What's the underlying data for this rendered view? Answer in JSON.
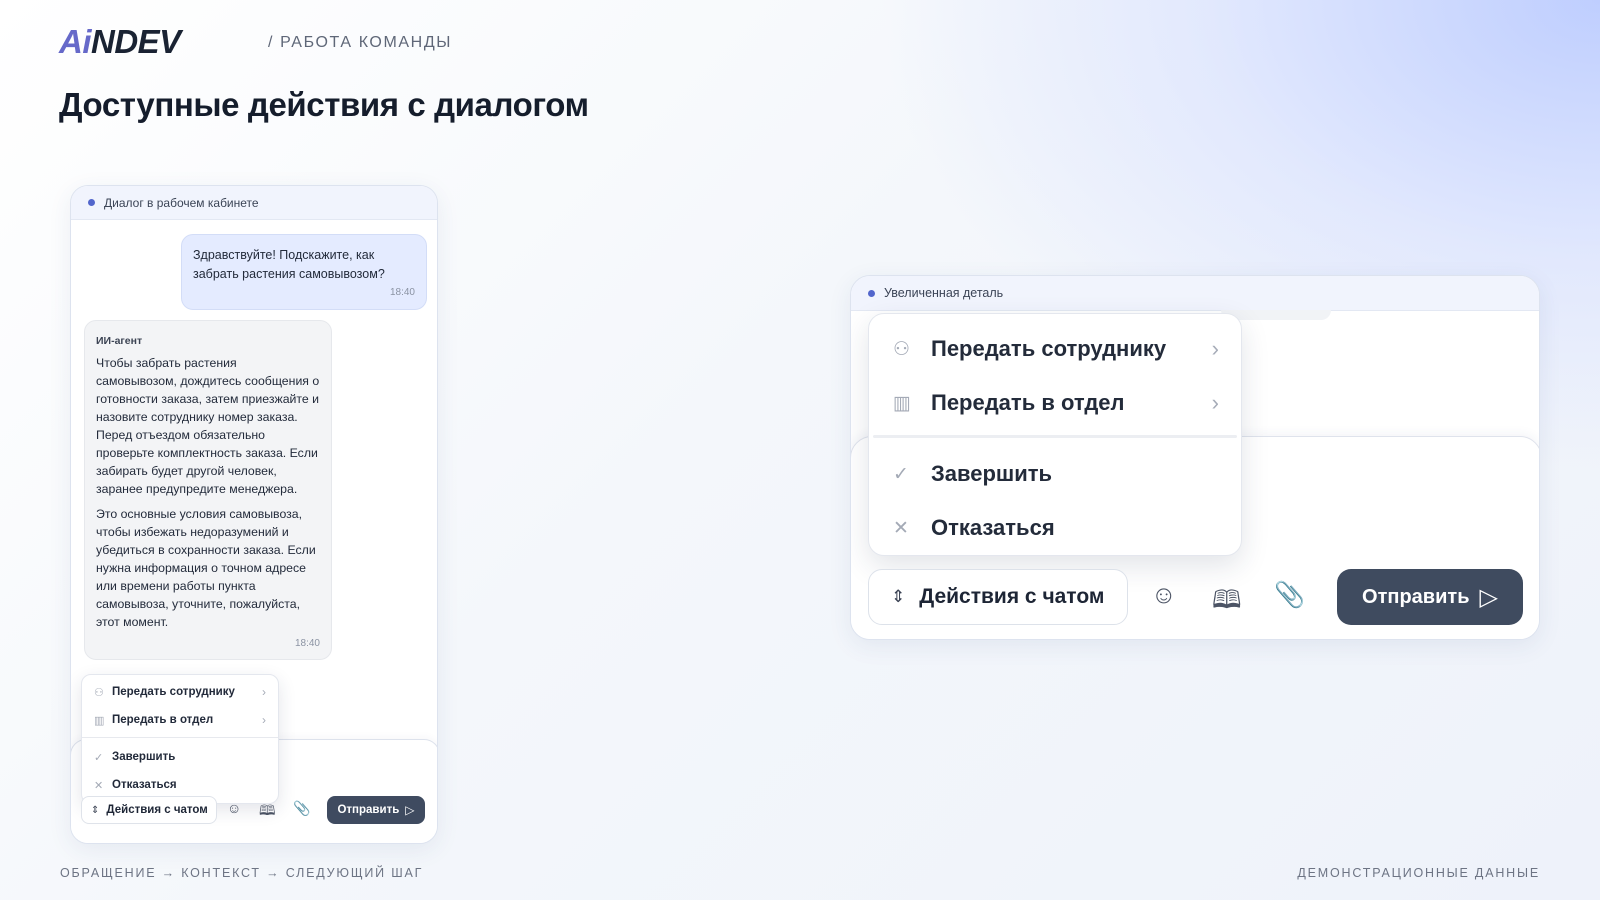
{
  "header": {
    "logo_ai": "Ai",
    "logo_rest": "NDEV",
    "breadcrumb": "/ РАБОТА КОМАНДЫ",
    "title": "Доступные действия с диалогом"
  },
  "footer": {
    "left": "ОБРАЩЕНИЕ → КОНТЕКСТ → СЛЕДУЮЩИЙ ШАГ",
    "right": "ДЕМОНСТРАЦИОННЫЕ ДАННЫЕ"
  },
  "colors": {
    "accent": "#5266cc",
    "user_bubble": "#e4ebff",
    "send_button": "#3f4b60",
    "logo_ai": "#6669c9"
  },
  "small_card": {
    "header": "Диалог в рабочем кабинете",
    "user_message": {
      "text": "Здравствуйте! Подскажите, как забрать растения самовывозом?",
      "time": "18:40"
    },
    "agent_message": {
      "sender": "ИИ-агент",
      "paragraph1": "Чтобы забрать растения самовывозом, дождитесь сообщения о готовности заказа, затем приезжайте и назовите сотруднику номер заказа. Перед отъездом обязательно проверьте комплектность заказа. Если забирать будет другой человек, заранее предупредите менеджера.",
      "paragraph2": "Это основные условия самовывоза, чтобы избежать недоразумений и убедиться в сохранности заказа. Если нужна информация о точном адресе или времени работы пункта самовывоза, уточните, пожалуйста, этот момент.",
      "time": "18:40"
    }
  },
  "big_card": {
    "header": "Увеличенная деталь"
  },
  "menu": {
    "items": [
      {
        "label": "Передать сотруднику",
        "icon": "person-plus-icon",
        "glyph": "⚇",
        "chevron": "›"
      },
      {
        "label": "Передать в отдел",
        "icon": "building-icon",
        "glyph": "▥",
        "chevron": "›"
      },
      {
        "label": "Завершить",
        "icon": "check-circle-icon",
        "glyph": "✓"
      },
      {
        "label": "Отказаться",
        "icon": "close-icon",
        "glyph": "✕"
      }
    ]
  },
  "toolbar": {
    "actions_label": "Действия с чатом",
    "actions_icon": "chevron-up-down-icon",
    "actions_glyph": "⇕",
    "emoji_glyph": "☺",
    "book_glyph": "🕮",
    "clip_glyph": "📎",
    "send_label": "Отправить",
    "send_glyph": "▷"
  }
}
